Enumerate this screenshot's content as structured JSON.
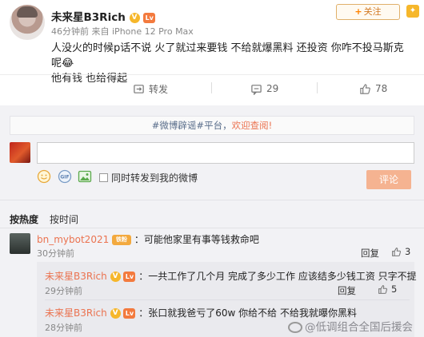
{
  "post": {
    "username": "未来星B3Rich",
    "v_badge": "V",
    "level_badge": "Lv",
    "time": "46分钟前",
    "source_prefix": "来自",
    "source": "iPhone 12 Pro Max",
    "follow_label": "关注",
    "follow_plus": "+",
    "content_line1": "人没火的时候p话不说 火了就过来要钱 不给就爆黑料 还投资 你咋不投马斯克呢😂",
    "content_line2": "他有钱 也给得起"
  },
  "actions": {
    "forward_label": "转发",
    "comment_count": "29",
    "like_count": "78"
  },
  "comment_box": {
    "notice_prefix": "#微博辟谣#平台，",
    "notice_highlight": "欢迎查阅!",
    "input_value": "",
    "repost_label": "同时转发到我的微博",
    "submit_label": "评论"
  },
  "sort": {
    "hot_label": "按热度",
    "time_label": "按时间"
  },
  "comments": [
    {
      "name": "bn_mybot2021",
      "badge": "铁粉",
      "text": "：可能他家里有事等钱救命吧",
      "time": "30分钟前",
      "reply_label": "回复",
      "likes": "3"
    },
    {
      "name": "未来星B3Rich",
      "text": "：一共工作了几个月 完成了多少工作 应该结多少钱工资 只字不提",
      "time": "29分钟前",
      "reply_label": "回复",
      "likes": "5"
    },
    {
      "name": "未来星B3Rich",
      "text": "：张口就我爸亏了60w 你给不给 不给我就曝你黑料",
      "time": "28分钟前"
    }
  ],
  "watermark": "@低调组合全国后援会",
  "colors": {
    "accent": "#eb7350",
    "follow_text": "#d27a24",
    "submit_bg": "#f5b391",
    "comment_area_bg": "#f2f2f5"
  }
}
